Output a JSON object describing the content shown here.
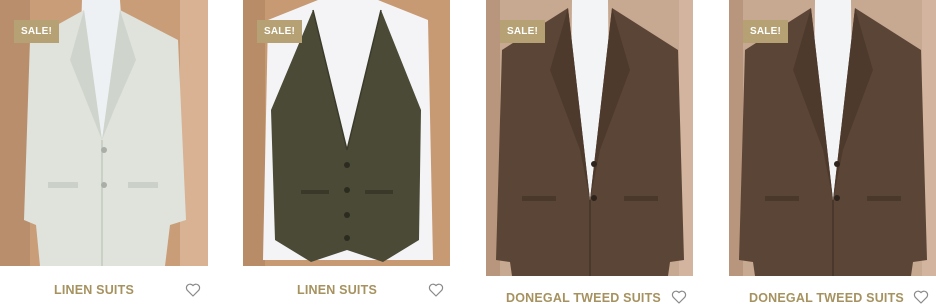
{
  "products": [
    {
      "sale_badge": "SALE!",
      "title": "LINEN SUITS",
      "wishlist_icon": "heart-outline-icon",
      "image": "light-linen-jacket"
    },
    {
      "sale_badge": "SALE!",
      "title": "LINEN SUITS",
      "wishlist_icon": "heart-outline-icon",
      "image": "olive-waistcoat"
    },
    {
      "sale_badge": "SALE!",
      "title": "DONEGAL TWEED SUITS",
      "wishlist_icon": "heart-outline-icon",
      "image": "brown-tweed-jacket"
    },
    {
      "sale_badge": "SALE!",
      "title": "DONEGAL TWEED SUITS",
      "wishlist_icon": "heart-outline-icon",
      "image": "brown-tweed-jacket"
    }
  ],
  "colors": {
    "badge": "#b5a173",
    "title": "#a6925f",
    "heart": "#8a8a8a"
  }
}
